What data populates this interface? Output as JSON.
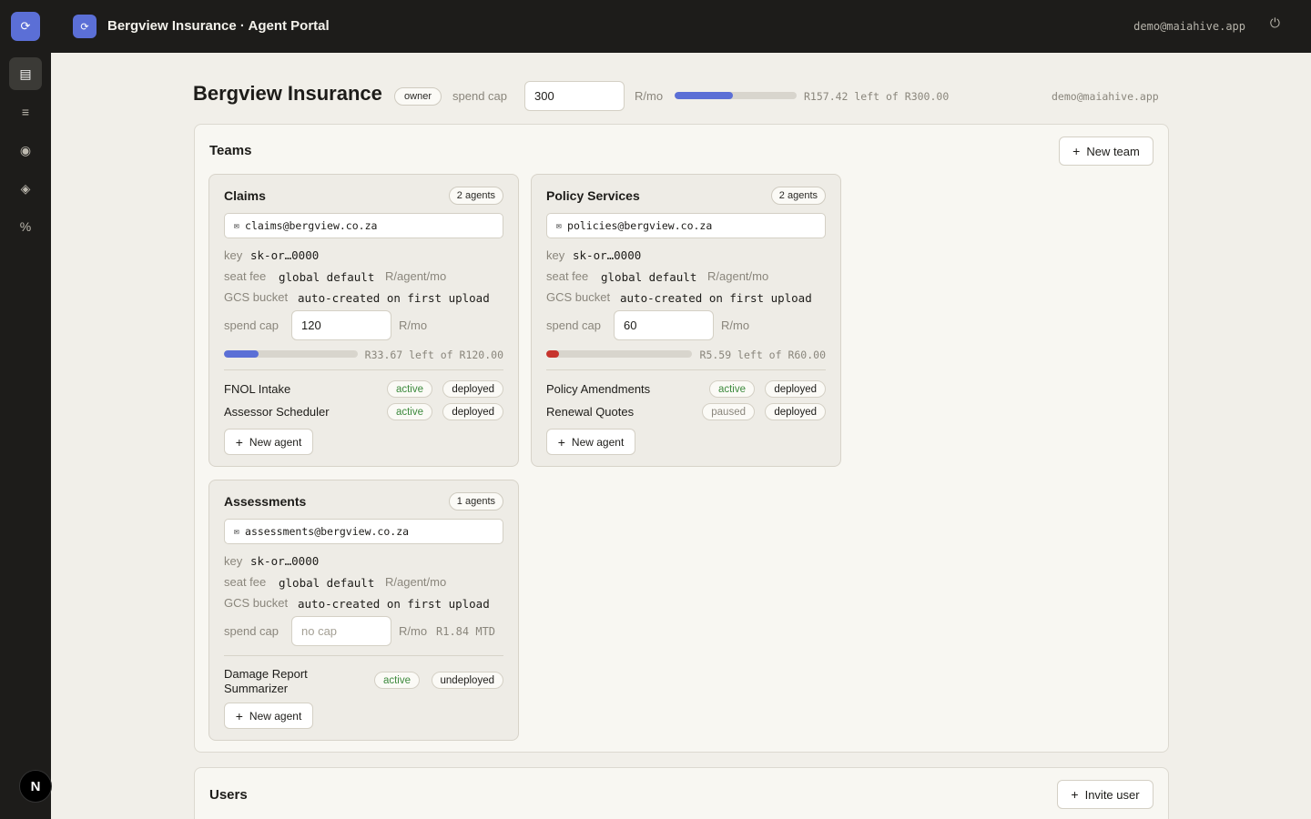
{
  "app": {
    "logo_glyph": "⟳",
    "title": "Bergview Insurance · Agent Portal",
    "user_email": "demo@maiahive.app",
    "power_icon": "⏻"
  },
  "sidebar": {
    "items": [
      {
        "name": "teams",
        "glyph": "▤"
      },
      {
        "name": "list",
        "glyph": "≡"
      },
      {
        "name": "radio",
        "glyph": "◉"
      },
      {
        "name": "diamond",
        "glyph": "◈"
      },
      {
        "name": "percent",
        "glyph": "%"
      }
    ],
    "avatar": "N"
  },
  "org": {
    "name": "Bergview Insurance",
    "role": "owner",
    "spend_cap_label": "spend cap",
    "spend_cap_value": "300",
    "unit": "R/mo",
    "usage_fraction": 0.475,
    "remaining": "R157.42 left of R300.00",
    "email": "demo@maiahive.app"
  },
  "teams_panel": {
    "title": "Teams",
    "new_team": "New team",
    "labels": {
      "key": "key",
      "seat_fee": "seat fee",
      "gcs_bucket": "GCS bucket",
      "spend_cap": "spend cap",
      "unit_agent": "R/agent/mo",
      "unit": "R/mo",
      "new_agent": "New agent"
    },
    "teams": [
      {
        "name": "Claims",
        "agents_count": "2 agents",
        "email": "claims@bergview.co.za",
        "key": "sk-or…0000",
        "seat_fee": "global default",
        "gcs_bucket": "auto-created on first upload",
        "spend_cap": "120",
        "usage_fraction": 0.26,
        "remaining": "R33.67 left of R120.00",
        "agents": [
          {
            "name": "FNOL Intake",
            "status": "active",
            "deploy": "deployed"
          },
          {
            "name": "Assessor Scheduler",
            "status": "active",
            "deploy": "deployed"
          }
        ]
      },
      {
        "name": "Policy Services",
        "agents_count": "2 agents",
        "email": "policies@bergview.co.za",
        "key": "sk-or…0000",
        "seat_fee": "global default",
        "gcs_bucket": "auto-created on first upload",
        "spend_cap": "60",
        "usage_fraction": 0.09,
        "remaining": "R5.59 left of R60.00",
        "agents": [
          {
            "name": "Policy Amendments",
            "status": "active",
            "deploy": "deployed"
          },
          {
            "name": "Renewal Quotes",
            "status": "paused",
            "deploy": "deployed"
          }
        ]
      },
      {
        "name": "Assessments",
        "agents_count": "1 agents",
        "email": "assessments@bergview.co.za",
        "key": "sk-or…0000",
        "seat_fee": "global default",
        "gcs_bucket": "auto-created on first upload",
        "spend_cap_placeholder": "no cap",
        "mtd": "R1.84 MTD",
        "agents": [
          {
            "name": "Damage Report Summarizer",
            "status": "active",
            "deploy": "undeployed"
          }
        ]
      }
    ]
  },
  "users_panel": {
    "title": "Users",
    "invite": "Invite user"
  },
  "colors": {
    "accent": "#5b6fd6",
    "danger": "#c7342d",
    "active_green": "#3d8a3d",
    "chrome": "#1d1c1a"
  }
}
